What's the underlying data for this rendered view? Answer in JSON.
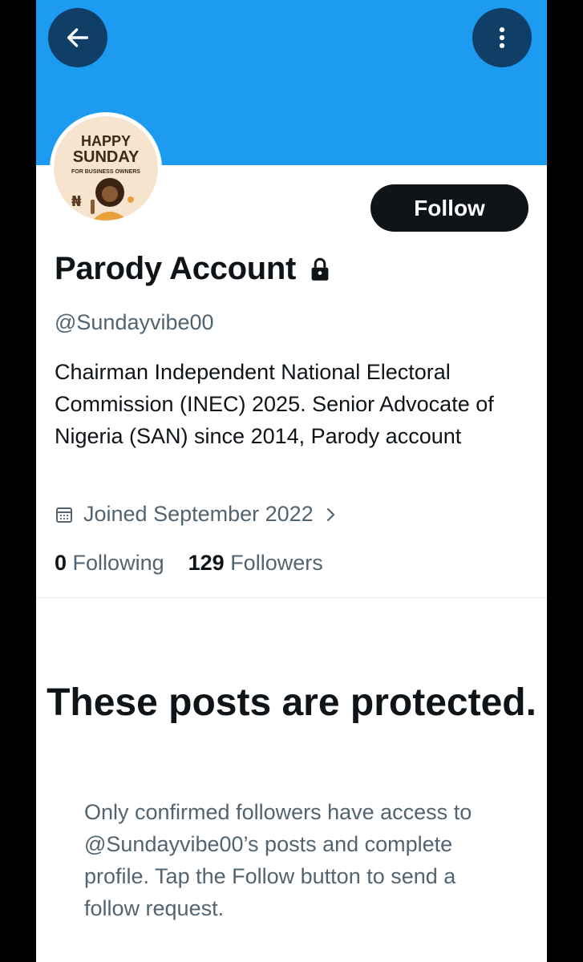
{
  "header": {
    "back_icon": "arrow-left-icon",
    "more_icon": "more-vertical-icon",
    "banner_color": "#1d9bf0"
  },
  "avatar": {
    "line1": "HAPPY",
    "line2": "SUNDAY",
    "line3": "FOR BUSINESS OWNERS"
  },
  "profile": {
    "follow_label": "Follow",
    "name": "Parody Account",
    "lock_icon": "lock-icon",
    "handle": "@Sundayvibe00",
    "bio": "Chairman Independent National Electoral Commission (INEC) 2025. Senior Advocate of Nigeria (SAN) since 2014, Parody account",
    "joined": "Joined September 2022",
    "following_count": "0",
    "following_label": "Following",
    "followers_count": "129",
    "followers_label": "Followers"
  },
  "protected": {
    "title": "These posts are protected.",
    "body": "Only confirmed followers have access to @Sundayvibe00’s posts and complete profile. Tap the Follow button to send a follow request."
  }
}
